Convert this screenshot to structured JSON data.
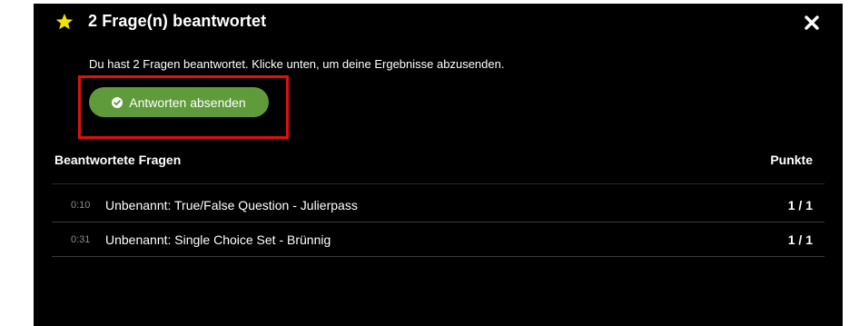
{
  "modal": {
    "title": "2 Frage(n) beantwortet",
    "icon_title": "star-icon",
    "icon_close": "close-icon",
    "message": "Du hast 2 Fragen beantwortet. Klicke unten, um deine Ergebnisse abzusenden.",
    "submit_label": "Antworten absenden",
    "submit_icon": "check-circle-icon",
    "colors": {
      "background": "#000000",
      "button": "#5f9a3b",
      "star": "#f2e600",
      "highlight": "#e01010"
    }
  },
  "answers": {
    "heading": "Beantwortete Fragen",
    "points_heading": "Punkte",
    "rows": [
      {
        "time": "0:10",
        "title": "Unbenannt: True/False Question - Julierpass",
        "score": "1 / 1"
      },
      {
        "time": "0:31",
        "title": "Unbenannt: Single Choice Set - Brünnig",
        "score": "1 / 1"
      }
    ]
  }
}
